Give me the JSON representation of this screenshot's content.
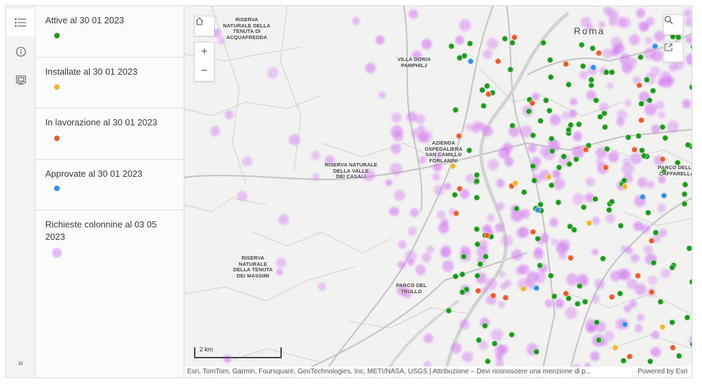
{
  "sidebar": {
    "icons": [
      {
        "name": "legend-icon",
        "active": true
      },
      {
        "name": "info-icon",
        "active": false
      },
      {
        "name": "basemap-icon",
        "active": false
      }
    ],
    "expand_label": "»"
  },
  "legend": [
    {
      "title": "Attive al 30 01 2023",
      "color": "#1a9a1a",
      "symbol": "dot"
    },
    {
      "title": "Installate al 30 01 2023",
      "color": "#f2b52a",
      "symbol": "dot"
    },
    {
      "title": "In lavorazione al 30 01 2023",
      "color": "#ea5a2c",
      "symbol": "dot"
    },
    {
      "title": "Approvate al 30 01 2023",
      "color": "#2f8ee6",
      "symbol": "dot"
    },
    {
      "title": "Richieste colonnine al 03 05 2023",
      "color": "#d57cf2",
      "symbol": "heat"
    }
  ],
  "map": {
    "city_label": "Roma",
    "places": [
      {
        "text": "RISERVA\nNATURALE DELLA\nTENUTA DI\nACQUAFREDDA"
      },
      {
        "text": "VILLA DORIA\nPAMPHILJ"
      },
      {
        "text": "AZIENDA\nOSPEDALIERA\nSAN CAMILLO\nFORLANINI"
      },
      {
        "text": "RISERVA NATURALE\nDELLA VALLE\nDEI CASALI"
      },
      {
        "text": "PARCO DELLA\nCAFFARELLA"
      },
      {
        "text": "RISERVA\nNATURALE\nDELLA TENUTA\nDEI MASSIMI"
      },
      {
        "text": "PARCO DEL\nTRULLO"
      }
    ],
    "controls": {
      "home": "home-icon",
      "zoom_in": "+",
      "zoom_out": "−",
      "search": "search-icon",
      "share": "share-icon"
    },
    "scale_label": "2 km",
    "attribution": "Esri, TomTom, Garmin, Foursquare, GeoTechnologies, Inc, METI/NASA, USGS | Attribuzione – Devi riconoscere una menzione di p...",
    "powered_by": "Powered by Esri"
  }
}
